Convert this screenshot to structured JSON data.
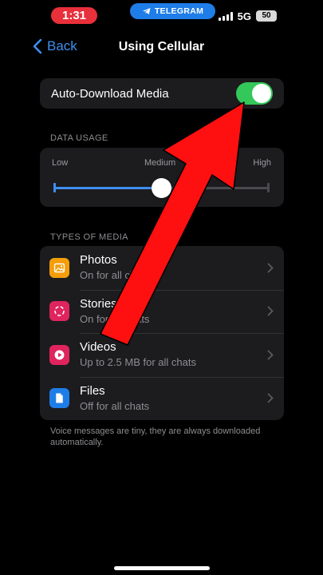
{
  "status_bar": {
    "time": "1:31",
    "app_badge": "TELEGRAM",
    "network": "5G",
    "battery": "50"
  },
  "nav": {
    "back_label": "Back",
    "title": "Using Cellular"
  },
  "auto_download": {
    "label": "Auto-Download Media",
    "enabled": true
  },
  "data_usage": {
    "header": "DATA USAGE",
    "low_label": "Low",
    "medium_label": "Medium",
    "high_label": "High",
    "level": "Medium"
  },
  "media": {
    "header": "TYPES OF MEDIA",
    "items": [
      {
        "title": "Photos",
        "subtitle": "On for all chats",
        "icon": "photo-icon",
        "color": "#f59e0b"
      },
      {
        "title": "Stories",
        "subtitle": "On for all chats",
        "icon": "stories-icon",
        "color": "#e0245e"
      },
      {
        "title": "Videos",
        "subtitle": "Up to 2.5 MB for all chats",
        "icon": "video-icon",
        "color": "#e0245e"
      },
      {
        "title": "Files",
        "subtitle": "Off for all chats",
        "icon": "file-icon",
        "color": "#1f7de8"
      }
    ],
    "footer": "Voice messages are tiny, they are always downloaded automatically."
  },
  "colors": {
    "accent": "#3e8ff0",
    "toggle_on": "#34c759",
    "overlay_arrow": "#ff1010"
  }
}
